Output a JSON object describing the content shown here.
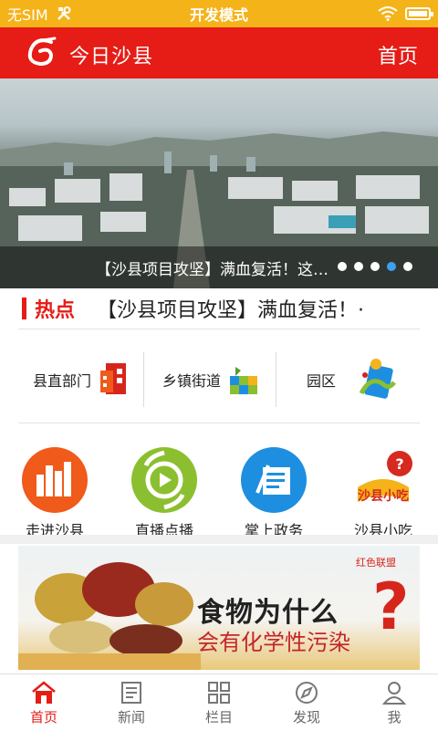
{
  "status_bar": {
    "carrier": "无SIM",
    "mode": "开发模式"
  },
  "header": {
    "app_title": "今日沙县",
    "home_link": "首页"
  },
  "banner": {
    "caption": "【沙县项目攻坚】满血复活！这…",
    "slide_count": 5,
    "active_slide": 3
  },
  "hot": {
    "label": "热点",
    "headline": "【沙县项目攻坚】满血复活！·"
  },
  "categories": [
    {
      "label": "县直部门",
      "icon": "office-icon"
    },
    {
      "label": "乡镇街道",
      "icon": "township-icon"
    },
    {
      "label": "园区",
      "icon": "park-icon"
    }
  ],
  "services": [
    {
      "label": "走进沙县",
      "icon": "city-buildings-icon",
      "color": "#f05a1a"
    },
    {
      "label": "直播点播",
      "icon": "play-icon",
      "color": "#8bbf2f"
    },
    {
      "label": "掌上政务",
      "icon": "document-icon",
      "color": "#1e8fe0"
    },
    {
      "label": "沙县小吃",
      "icon": "snack-logo-icon",
      "color": "#d62a1f"
    }
  ],
  "ad": {
    "brand": "红色联盟",
    "title": "食物为什么",
    "subtitle": "会有化学性污染",
    "mark": "?"
  },
  "tabs": [
    {
      "label": "首页",
      "icon": "home-icon",
      "active": true
    },
    {
      "label": "新闻",
      "icon": "news-icon",
      "active": false
    },
    {
      "label": "栏目",
      "icon": "grid-icon",
      "active": false
    },
    {
      "label": "发现",
      "icon": "compass-icon",
      "active": false
    },
    {
      "label": "我",
      "icon": "user-icon",
      "active": false
    }
  ],
  "colors": {
    "brand_red": "#e61c16",
    "status_orange": "#f5b31a",
    "dot_active": "#3ea0f0"
  }
}
